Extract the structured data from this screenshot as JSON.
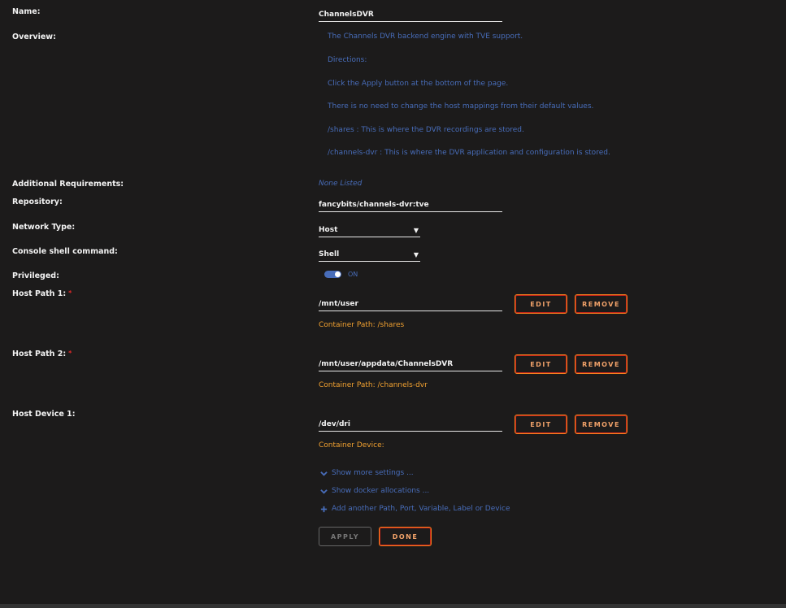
{
  "labels": {
    "name": "Name:",
    "overview": "Overview:",
    "additional_requirements": "Additional Requirements:",
    "repository": "Repository:",
    "network_type": "Network Type:",
    "console_shell": "Console shell command:",
    "privileged": "Privileged:",
    "host_path_1": "Host Path 1:",
    "host_path_2": "Host Path 2:",
    "host_device_1": "Host Device 1:",
    "required_mark": "*"
  },
  "name_value": "ChannelsDVR",
  "overview_lines": [
    "The Channels DVR backend engine with TVE support.",
    "Directions:",
    "Click the Apply button at the bottom of the page.",
    "There is no need to change the host mappings from their default values.",
    "/shares : This is where the DVR recordings are stored.",
    "/channels-dvr : This is where the DVR application and configuration is stored."
  ],
  "additional_requirements_value": "None Listed",
  "repository_value": "fancybits/channels-dvr:tve",
  "network_type_value": "Host",
  "console_shell_value": "Shell",
  "privileged_state": "ON",
  "host_path_1": {
    "value": "/mnt/user",
    "container": "Container Path: /shares"
  },
  "host_path_2": {
    "value": "/mnt/user/appdata/ChannelsDVR",
    "container": "Container Path: /channels-dvr"
  },
  "host_device_1": {
    "value": "/dev/dri",
    "container": "Container Device:"
  },
  "buttons": {
    "edit": "EDIT",
    "remove": "REMOVE",
    "apply": "APPLY",
    "done": "DONE"
  },
  "links": {
    "show_more": "Show more settings ...",
    "show_docker": "Show docker allocations ...",
    "add_another": "Add another Path, Port, Variable, Label or Device"
  },
  "colors": {
    "accent_blue": "#486dba",
    "accent_orange": "#f57f1e",
    "background": "#1c1b1b"
  }
}
